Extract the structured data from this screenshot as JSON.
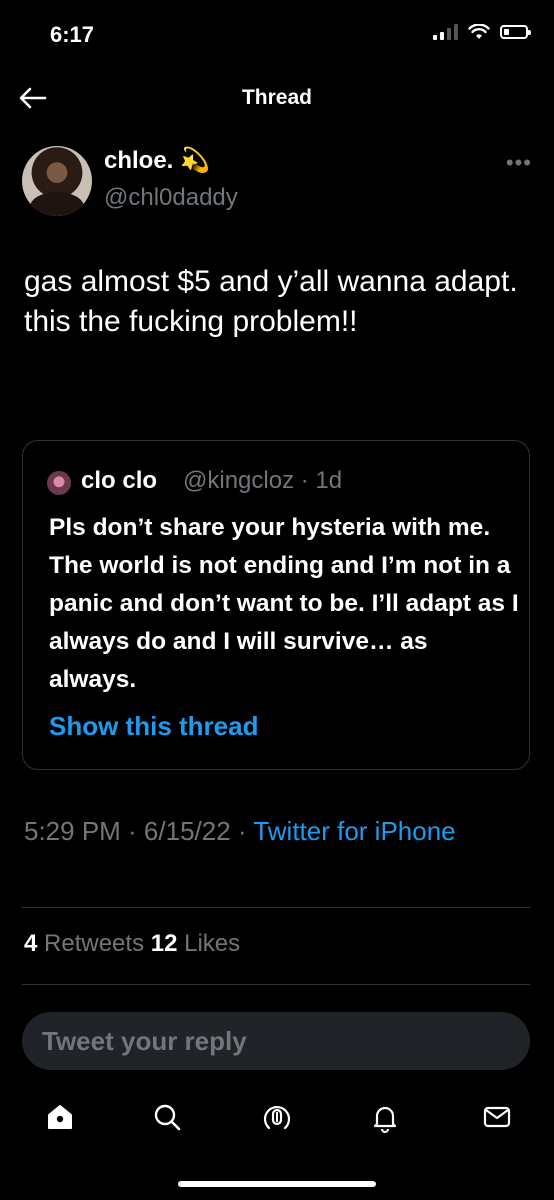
{
  "status_bar": {
    "time": "6:17"
  },
  "nav": {
    "title": "Thread"
  },
  "tweet": {
    "name": "chloe. 💫",
    "handle": "@chl0daddy",
    "text": "gas almost $5 and y’all wanna adapt. this the fucking problem!!",
    "timestamp": "5:29 PM · 6/15/22 · ",
    "source": "Twitter for iPhone",
    "retweets_count": "4",
    "retweets_label": " Retweets  ",
    "likes_count": "12",
    "likes_label": " Likes"
  },
  "quote": {
    "name": "clo clo",
    "handle": "@kingcloz · 1d",
    "text": "Pls don’t share your hysteria with me. The world is not ending and I’m not in a panic and don’t want to be. I’ll adapt as I always do and I will survive… as always.",
    "link": "Show this thread"
  },
  "reply": {
    "placeholder": "Tweet your reply"
  },
  "tabbar": [
    "home-icon",
    "search-icon",
    "spaces-icon",
    "notifications-icon",
    "messages-icon"
  ],
  "colors": {
    "accent": "#1d9bf0",
    "muted": "#71767b",
    "background": "#000000"
  }
}
